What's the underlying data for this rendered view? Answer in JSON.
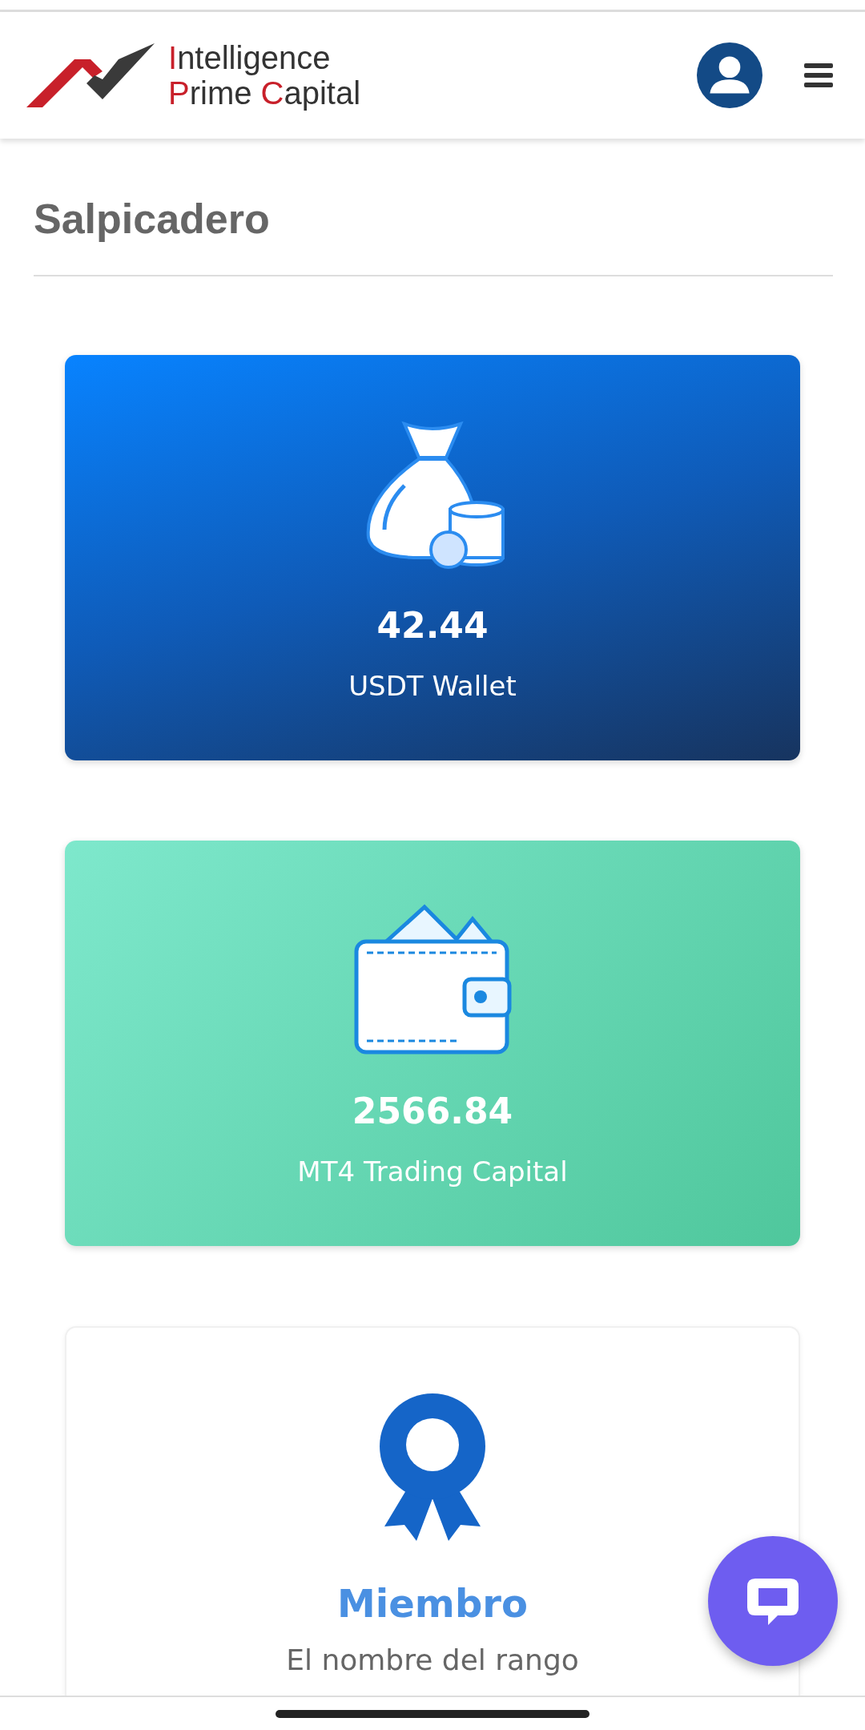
{
  "header": {
    "logo_lines": [
      [
        {
          "text": "I",
          "accent": true
        },
        {
          "text": "ntelligence",
          "accent": false
        }
      ],
      [
        {
          "text": "P",
          "accent": true
        },
        {
          "text": "rime ",
          "accent": false
        },
        {
          "text": "C",
          "accent": true
        },
        {
          "text": "apital",
          "accent": false
        }
      ]
    ]
  },
  "page_title": "Salpicadero",
  "cards": [
    {
      "kind": "money-bag",
      "value": "42.44",
      "label": "USDT Wallet"
    },
    {
      "kind": "wallet",
      "value": "2566.84",
      "label": "MT4 Trading Capital"
    },
    {
      "kind": "rank",
      "value": "Miembro",
      "label": "El nombre del rango"
    }
  ]
}
